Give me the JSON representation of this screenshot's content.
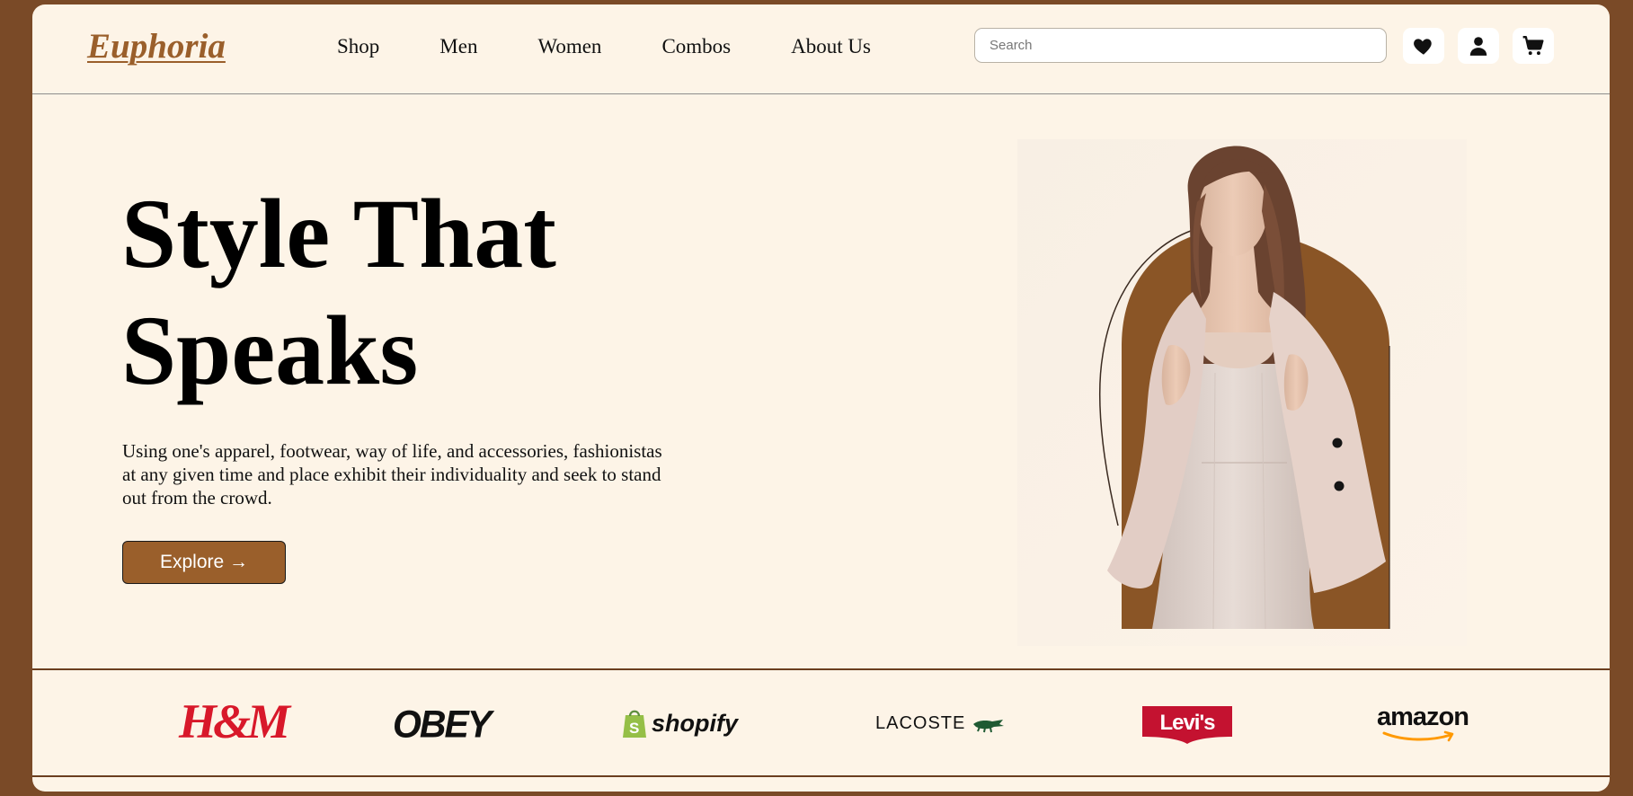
{
  "brand": {
    "logo": "Euphoria"
  },
  "nav": {
    "links": [
      "Shop",
      "Men",
      "Women",
      "Combos",
      "About Us"
    ]
  },
  "search": {
    "placeholder": "Search",
    "value": ""
  },
  "icons": [
    "heart-icon",
    "user-icon",
    "cart-icon"
  ],
  "hero": {
    "title_line1": "Style That",
    "title_line2": "Speaks",
    "description": "Using one's apparel, footwear, way of life, and accessories, fashionistas at any given time and place exhibit their individuality and seek to stand out from the crowd.",
    "explore_label": "Explore →"
  },
  "brands": [
    "H&M",
    "OBEY",
    "shopify",
    "LACOSTE",
    "Levi's",
    "amazon"
  ],
  "colors": {
    "accent": "#9a5f2b",
    "background": "#fdf4e7",
    "frame": "#7a4a27",
    "hm_red": "#d8182a",
    "levis_red": "#c41230",
    "shopify_green": "#95bf47",
    "amazon_orange": "#ff9900"
  }
}
